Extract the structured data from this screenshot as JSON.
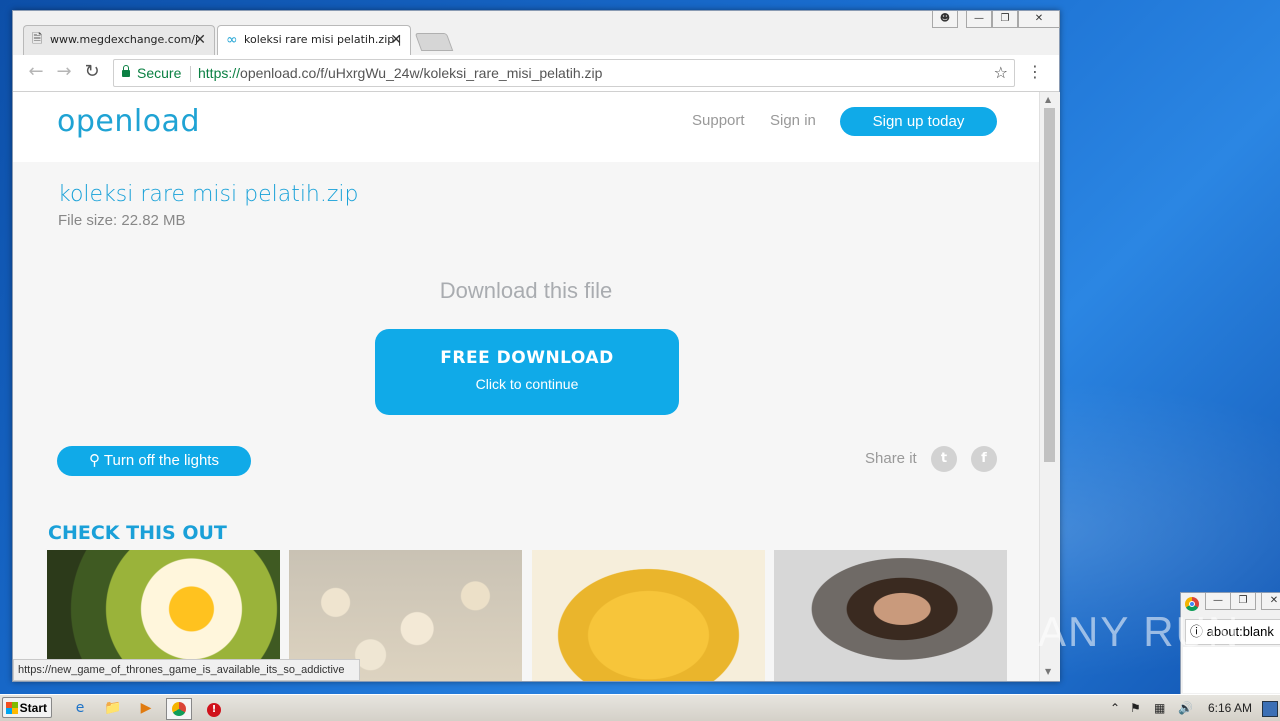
{
  "browser": {
    "tabs": [
      {
        "title": "www.megdexchange.com/j"
      },
      {
        "title": "koleksi rare misi pelatih.zip |"
      }
    ],
    "secure_label": "Secure",
    "url_protocol": "https://",
    "url_rest": "openload.co/f/uHxrgWu_24w/koleksi_rare_misi_pelatih.zip",
    "status_url": "https://new_game_of_thrones_game_is_available_its_so_addictive"
  },
  "site": {
    "logo": "openload",
    "nav": {
      "support": "Support",
      "sign_in": "Sign in",
      "sign_up": "Sign up today"
    },
    "file_name": "koleksi rare misi pelatih.zip",
    "file_size": "File size: 22.82 MB",
    "download_title": "Download this file",
    "download_button": {
      "main": "FREE DOWNLOAD",
      "sub": "Click to continue"
    },
    "lights_button": "Turn off the lights",
    "share_label": "Share it",
    "check_title": "CHECK THIS OUT"
  },
  "second_window": {
    "url": "about:blank"
  },
  "watermark": "ANY RUN",
  "taskbar": {
    "start": "Start",
    "clock": "6:16 AM"
  },
  "colors": {
    "accent": "#10aae8",
    "secure": "#0b8043"
  }
}
